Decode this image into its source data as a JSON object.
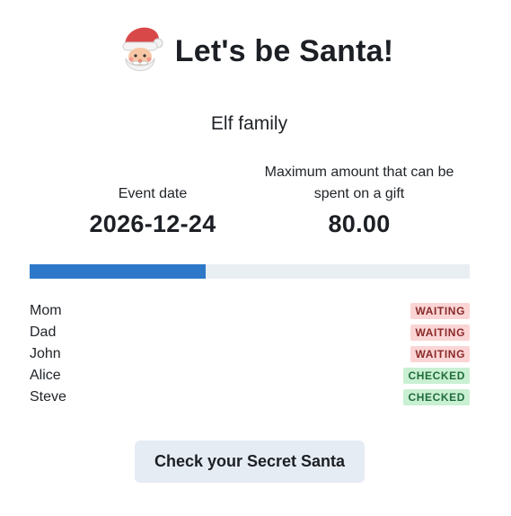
{
  "header": {
    "icon": "santa-face-icon",
    "title": "Let's be Santa!"
  },
  "group": {
    "name": "Elf family"
  },
  "stats": {
    "event_date_label": "Event date",
    "event_date_value": "2026-12-24",
    "max_amount_label": "Maximum amount that can be spent on a gift",
    "max_amount_value": "80.00"
  },
  "progress": {
    "fraction": 0.4,
    "color": "#2e78c9",
    "track_color": "#e9eef3"
  },
  "participants": [
    {
      "name": "Mom",
      "status": "WAITING",
      "state": "waiting"
    },
    {
      "name": "Dad",
      "status": "WAITING",
      "state": "waiting"
    },
    {
      "name": "John",
      "status": "WAITING",
      "state": "waiting"
    },
    {
      "name": "Alice",
      "status": "CHECKED",
      "state": "checked"
    },
    {
      "name": "Steve",
      "status": "CHECKED",
      "state": "checked"
    }
  ],
  "actions": {
    "check_label": "Check your Secret Santa"
  },
  "colors": {
    "waiting_bg": "#fbd5d5",
    "waiting_text": "#8a2a2a",
    "checked_bg": "#c9f0d3",
    "checked_text": "#1f6b3a",
    "button_bg": "#e6ecf3"
  }
}
